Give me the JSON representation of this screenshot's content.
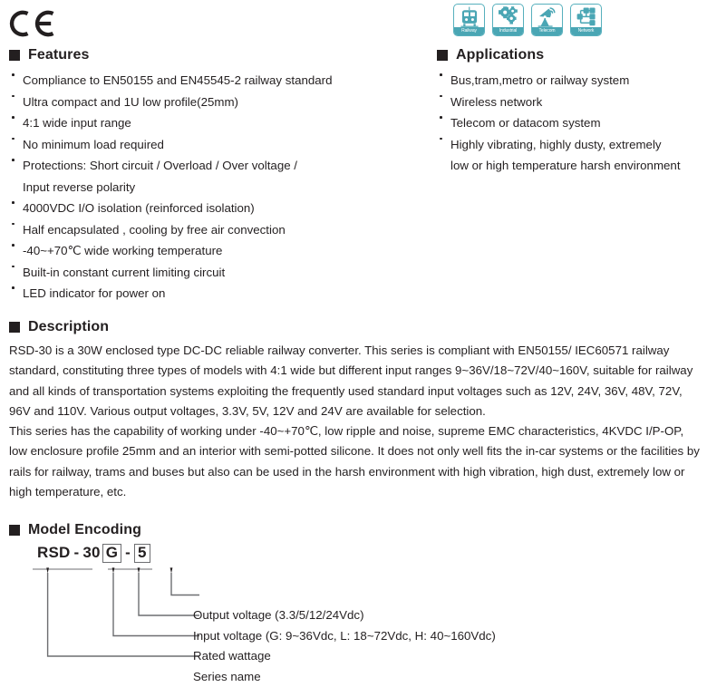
{
  "certification": {
    "mark": "CE",
    "name": "ce-mark"
  },
  "features": {
    "heading": "Features",
    "items": [
      {
        "text": "Compliance to EN50155 and EN45545-2 railway standard"
      },
      {
        "text": "Ultra compact and 1U low profile(25mm)"
      },
      {
        "text": "4:1 wide input range"
      },
      {
        "text": "No minimum load required"
      },
      {
        "text": "Protections: Short circuit / Overload / Over voltage /",
        "continuation": "Input reverse polarity"
      },
      {
        "text": "4000VDC I/O isolation (reinforced isolation)"
      },
      {
        "text": "Half encapsulated , cooling by free air convection"
      },
      {
        "text": "-40~+70℃ wide working temperature"
      },
      {
        "text": "Built-in constant current limiting circuit"
      },
      {
        "text": "LED indicator for power on"
      }
    ]
  },
  "applications": {
    "heading": "Applications",
    "items": [
      {
        "text": "Bus,tram,metro or railway system"
      },
      {
        "text": "Wireless network"
      },
      {
        "text": "Telecom or datacom system"
      },
      {
        "text": "Highly vibrating, highly dusty,  extremely",
        "continuation": "low or high temperature harsh environment"
      }
    ],
    "icons": [
      {
        "name": "railway-icon",
        "caption": "Railway"
      },
      {
        "name": "industrial-gears-icon",
        "caption": "Industrial"
      },
      {
        "name": "telecom-satellite-dish-icon",
        "caption": "Telecom"
      },
      {
        "name": "network-nodes-icon",
        "caption": "Network"
      }
    ],
    "icon_color": "#4aa6b4"
  },
  "description": {
    "heading": "Description",
    "paragraph1": "RSD-30 is a 30W enclosed type DC-DC reliable railway converter. This series is compliant with EN50155/ IEC60571 railway standard, constituting three types of models with 4:1 wide but different input ranges 9~36V/18~72V/40~160V, suitable for railway and all kinds of transportation systems exploiting the frequently used standard input voltages such as 12V, 24V, 36V, 48V, 72V, 96V and 110V. Various output voltages, 3.3V, 5V, 12V and 24V are available for selection.",
    "paragraph2": "This series has the capability of working under -40~+70℃, low ripple and noise, supreme EMC characteristics, 4KVDC I/P-OP, low enclosure profile 25mm and an interior with semi-potted silicone. It does not only well fits the in-car systems or the facilities by rails for railway, trams and buses but also can be used in the harsh environment with high vibration, high dust, extremely low or high temperature, etc."
  },
  "model_encoding": {
    "heading": "Model Encoding",
    "code": {
      "series": "RSD",
      "dash1": "-",
      "wattage": "30",
      "input_voltage": "G",
      "dash2": "-",
      "output_voltage": "5"
    },
    "legend": [
      {
        "label": "Output voltage (3.3/5/12/24Vdc)"
      },
      {
        "label": "Input voltage (G: 9~36Vdc, L: 18~72Vdc, H: 40~160Vdc)"
      },
      {
        "label": "Rated wattage"
      },
      {
        "label": "Series name"
      }
    ]
  }
}
